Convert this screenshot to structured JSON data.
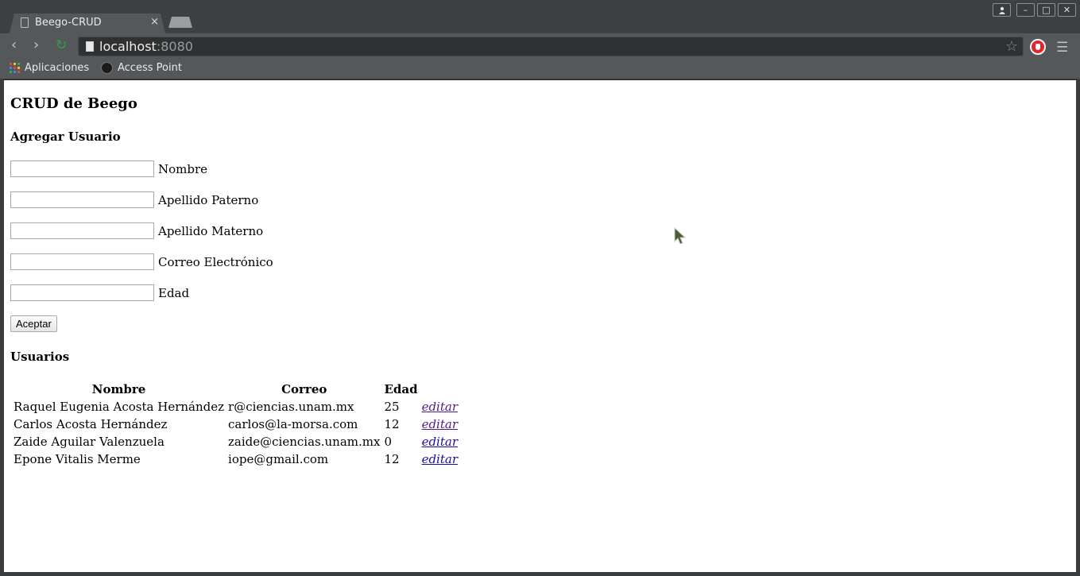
{
  "browser": {
    "tab_title": "Beego-CRUD",
    "tab_close": "×",
    "url_host": "localhost",
    "url_port": ":8080",
    "bookmarks": [
      {
        "label": "Aplicaciones",
        "icon": "apps-grid-icon"
      },
      {
        "label": "Access Point",
        "icon": "github-icon"
      }
    ],
    "window_buttons": {
      "minimize": "–",
      "maximize": "□",
      "close": "✕"
    }
  },
  "page": {
    "title": "CRUD de Beego",
    "add_section": "Agregar Usuario",
    "fields": [
      {
        "label": "Nombre",
        "value": ""
      },
      {
        "label": "Apellido Paterno",
        "value": ""
      },
      {
        "label": "Apellido Materno",
        "value": ""
      },
      {
        "label": "Correo Electrónico",
        "value": ""
      },
      {
        "label": "Edad",
        "value": ""
      }
    ],
    "submit_label": "Aceptar",
    "users_section": "Usuarios",
    "table": {
      "headers": [
        "Nombre",
        "Correo",
        "Edad",
        ""
      ],
      "rows": [
        {
          "name": "Raquel Eugenia Acosta Hernández",
          "email": "r@ciencias.unam.mx",
          "age": "25",
          "action": "editar"
        },
        {
          "name": "Carlos Acosta Hernández",
          "email": "carlos@la-morsa.com",
          "age": "12",
          "action": "editar"
        },
        {
          "name": "Zaide Aguilar Valenzuela",
          "email": "zaide@ciencias.unam.mx",
          "age": "0",
          "action": "editar"
        },
        {
          "name": "Epone Vitalis Merme",
          "email": "iope@gmail.com",
          "age": "12",
          "action": "editar"
        }
      ]
    }
  },
  "colors": {
    "link": "#1a0dab",
    "visited_link": "#551a8b",
    "reload": "#2ea24a",
    "stop_extension": "#e0262b"
  }
}
